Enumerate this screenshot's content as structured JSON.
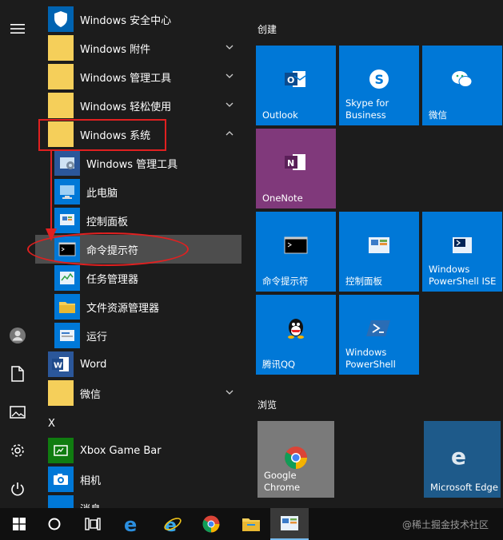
{
  "left_rail": {
    "items": [
      {
        "icon": "hamburger-menu-icon"
      },
      {
        "icon": "user-avatar-icon"
      },
      {
        "icon": "documents-icon"
      },
      {
        "icon": "pictures-icon"
      },
      {
        "icon": "settings-gear-icon"
      },
      {
        "icon": "power-icon"
      }
    ]
  },
  "app_list": {
    "rows": [
      {
        "label": "Windows 安全中心",
        "icon": "shield-icon",
        "expandable": false
      },
      {
        "label": "Windows 附件",
        "icon": "folder-icon",
        "expandable": true
      },
      {
        "label": "Windows 管理工具",
        "icon": "folder-icon",
        "expandable": true
      },
      {
        "label": "Windows 轻松使用",
        "icon": "folder-icon",
        "expandable": true
      },
      {
        "label": "Windows 系统",
        "icon": "folder-icon",
        "expandable": true,
        "expanded": true
      },
      {
        "label": "Windows 管理工具",
        "icon": "admin-tools-icon",
        "sub": true
      },
      {
        "label": "此电脑",
        "icon": "this-pc-icon",
        "sub": true
      },
      {
        "label": "控制面板",
        "icon": "control-panel-icon",
        "sub": true
      },
      {
        "label": "命令提示符",
        "icon": "command-prompt-icon",
        "sub": true,
        "selected": true
      },
      {
        "label": "任务管理器",
        "icon": "task-manager-icon",
        "sub": true
      },
      {
        "label": "文件资源管理器",
        "icon": "file-explorer-icon",
        "sub": true
      },
      {
        "label": "运行",
        "icon": "run-icon",
        "sub": true
      },
      {
        "label": "Word",
        "icon": "word-icon"
      },
      {
        "label": "微信",
        "icon": "folder-icon",
        "expandable": true
      },
      {
        "letter": "X"
      },
      {
        "label": "Xbox Game Bar",
        "icon": "xbox-game-bar-icon"
      },
      {
        "label": "相机",
        "icon": "camera-icon"
      },
      {
        "label": "消息",
        "icon": "messaging-icon"
      }
    ]
  },
  "tiles": {
    "group_create": "创建",
    "group_browse": "浏览",
    "items": [
      {
        "label": "Outlook",
        "icon": "outlook-icon"
      },
      {
        "label": "Skype for\nBusiness",
        "icon": "skype-icon"
      },
      {
        "label": "微信",
        "icon": "wechat-icon"
      },
      {
        "label": "OneNote",
        "icon": "onenote-icon"
      },
      {
        "label": "命令提示符",
        "icon": "command-prompt-icon"
      },
      {
        "label": "控制面板",
        "icon": "control-panel-icon"
      },
      {
        "label": "Windows\nPowerShell ISE",
        "icon": "powershell-ise-icon"
      },
      {
        "label": "腾讯QQ",
        "icon": "qq-icon"
      },
      {
        "label": "Windows\nPowerShell",
        "icon": "powershell-icon"
      },
      {
        "label": "Google Chrome",
        "icon": "chrome-icon"
      },
      {
        "label": "Microsoft Edge",
        "icon": "edge-icon"
      }
    ]
  },
  "taskbar": {
    "items": [
      {
        "icon": "windows-start-icon"
      },
      {
        "icon": "cortana-search-icon"
      },
      {
        "icon": "task-view-icon"
      },
      {
        "icon": "edge-icon"
      },
      {
        "icon": "internet-explorer-icon"
      },
      {
        "icon": "chrome-icon"
      },
      {
        "icon": "file-explorer-icon"
      },
      {
        "icon": "control-panel-icon"
      }
    ],
    "watermark": "@稀土掘金技术社区"
  },
  "colors": {
    "tile_blue": "#0078d7",
    "onenote_purple": "#80397b",
    "background": "#1c1c1c",
    "annotation_red": "#e02020"
  }
}
